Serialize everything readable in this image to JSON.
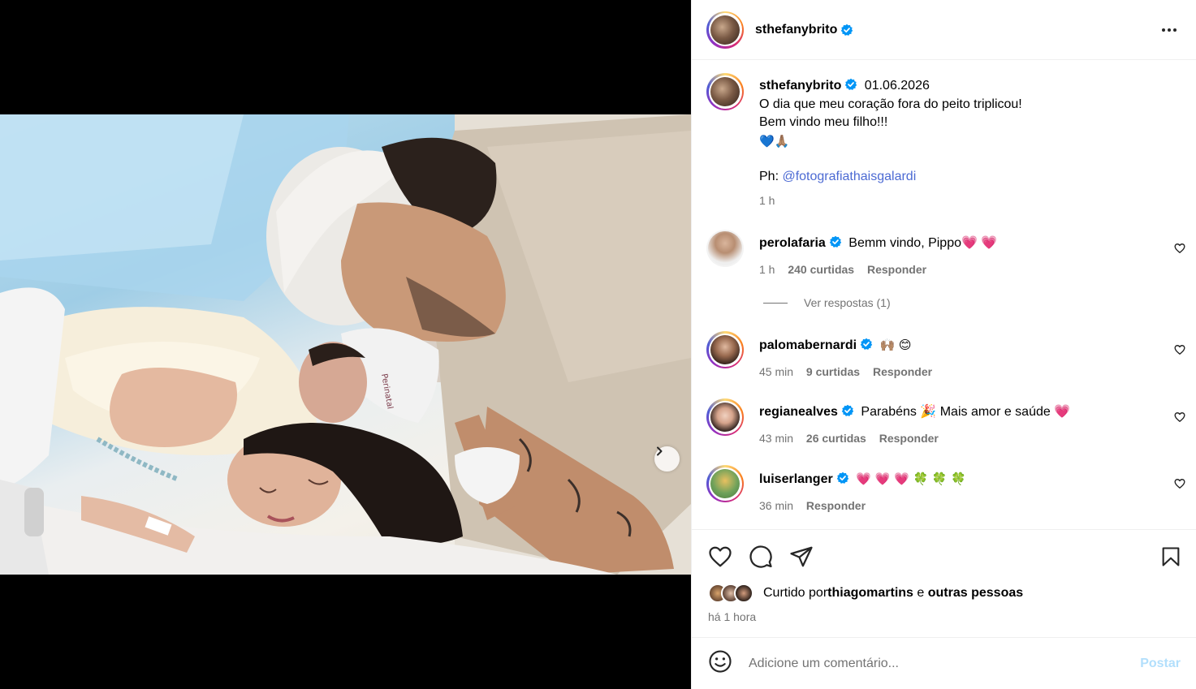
{
  "header": {
    "username": "sthefanybrito",
    "verified": true,
    "more_icon": "more-horizontal-icon"
  },
  "caption": {
    "username": "sthefanybrito",
    "date": "01.06.2026",
    "lines": [
      "O dia que meu coração fora do peito triplicou!",
      "Bem vindo meu filho!!!",
      "💙🙏🏽"
    ],
    "credit_prefix": "Ph: ",
    "credit_link": "@fotografiathaisgalardi",
    "time": "1 h"
  },
  "comments": [
    {
      "username": "perolafaria",
      "text": "Bemm vindo, Pippo💗 💗",
      "time": "1 h",
      "likes": "240 curtidas",
      "reply": "Responder",
      "view_replies": "Ver respostas (1)"
    },
    {
      "username": "palomabernardi",
      "text": "🙌🏽 😊",
      "time": "45 min",
      "likes": "9 curtidas",
      "reply": "Responder"
    },
    {
      "username": "regianealves",
      "text": "Parabéns 🎉  Mais amor e saúde 💗",
      "time": "43 min",
      "likes": "26 curtidas",
      "reply": "Responder"
    },
    {
      "username": "luiserlanger",
      "text": "💗 💗 💗 🍀 🍀 🍀",
      "time": "36 min",
      "reply": "Responder"
    }
  ],
  "actions": {
    "liked_prefix": "Curtido por ",
    "liked_user": "thiagomartins",
    "liked_joiner": " e ",
    "liked_others": "outras pessoas",
    "time_ago": "há 1 hora"
  },
  "add_comment": {
    "placeholder": "Adicione um comentário...",
    "post_label": "Postar"
  },
  "carousel": {
    "slide_count": 4,
    "current": 1
  },
  "colors": {
    "verified": "#0095f6",
    "link": "#4c6ad3",
    "post_disabled": "#b2dffc",
    "meta_gray": "#737373"
  }
}
